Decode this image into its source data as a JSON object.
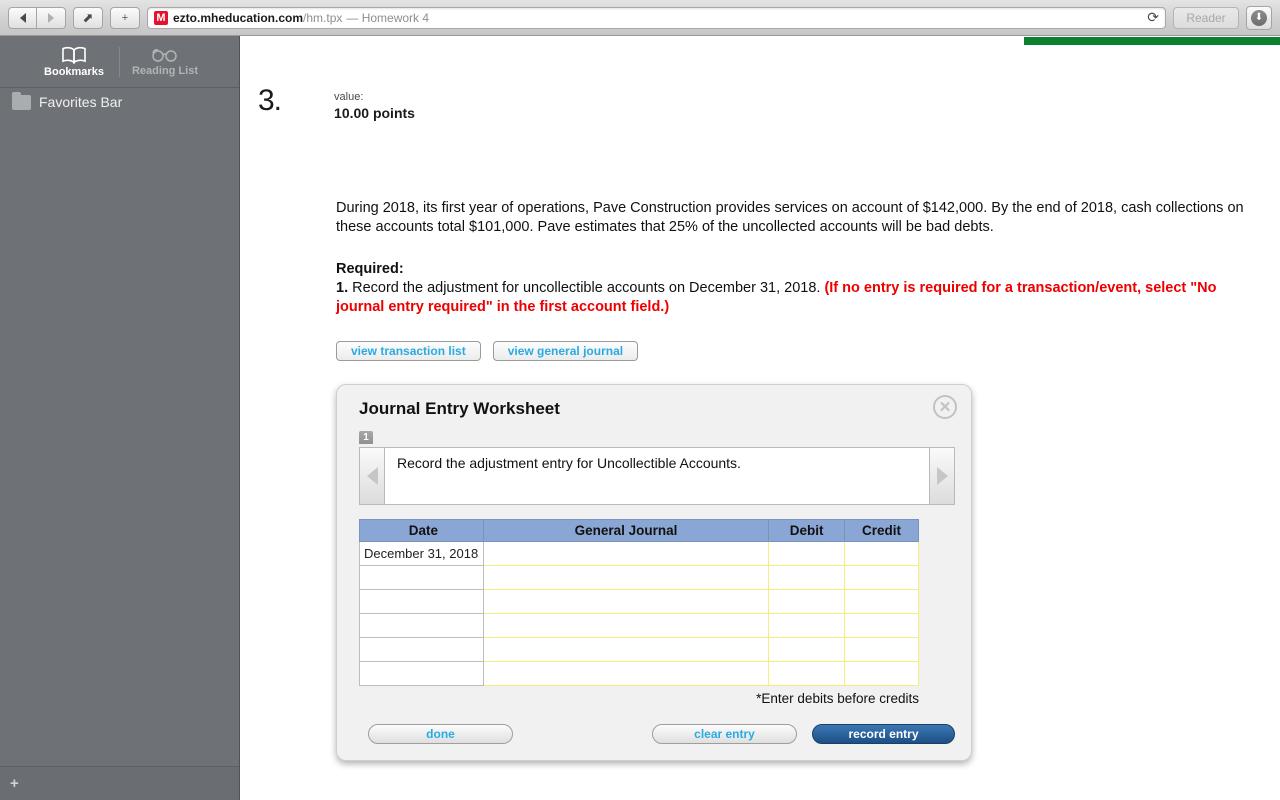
{
  "browser": {
    "back_icon": "back-arrow-icon",
    "forward_icon": "forward-arrow-icon",
    "share_icon": "share-icon",
    "share_glyph": "⬈",
    "new_tab_label": "+",
    "favicon_letter": "M",
    "url_host": "ezto.mheducation.com",
    "url_path": "/hm.tpx",
    "page_title": "— Homework 4",
    "reload_glyph": "⟳",
    "reader_label": "Reader",
    "download_glyph": "⬇"
  },
  "sidebar": {
    "tabs": [
      {
        "label": "Bookmarks",
        "icon": "book-icon"
      },
      {
        "label": "Reading List",
        "icon": "glasses-icon"
      }
    ],
    "items": [
      {
        "label": "Favorites Bar",
        "icon": "folder-icon"
      }
    ],
    "add_label": "+"
  },
  "question": {
    "number": "3.",
    "value_label": "value:",
    "points": "10.00 points",
    "problem_text": "During 2018, its first year of operations, Pave Construction provides services on account of $142,000. By the end of 2018, cash collections on these accounts total $101,000. Pave estimates that 25% of the uncollected accounts will be bad debts.",
    "required_title": "Required:",
    "required_number": "1.",
    "required_text": " Record the adjustment for uncollectible accounts on December 31, 2018. ",
    "required_note": "(If no entry is required for a transaction/event, select \"No journal entry required\" in the first account field.)",
    "view_buttons": [
      {
        "label": "view transaction list"
      },
      {
        "label": "view general journal"
      }
    ]
  },
  "worksheet": {
    "title": "Journal Entry Worksheet",
    "close_label": "✕",
    "tabs": [
      {
        "label": "1"
      }
    ],
    "prev_icon": "chevron-left-icon",
    "next_icon": "chevron-right-icon",
    "instruction": "Record the adjustment entry for Uncollectible Accounts.",
    "columns": [
      "Date",
      "General Journal",
      "Debit",
      "Credit"
    ],
    "rows": [
      {
        "date": "December 31, 2018",
        "general_journal": "",
        "debit": "",
        "credit": ""
      },
      {
        "date": "",
        "general_journal": "",
        "debit": "",
        "credit": ""
      },
      {
        "date": "",
        "general_journal": "",
        "debit": "",
        "credit": ""
      },
      {
        "date": "",
        "general_journal": "",
        "debit": "",
        "credit": ""
      },
      {
        "date": "",
        "general_journal": "",
        "debit": "",
        "credit": ""
      },
      {
        "date": "",
        "general_journal": "",
        "debit": "",
        "credit": ""
      }
    ],
    "note": "*Enter debits before credits",
    "buttons": {
      "done": "done",
      "clear": "clear entry",
      "record": "record entry"
    }
  },
  "colors": {
    "progress_green": "#0d8030",
    "header_blue": "#8aa6d4",
    "link_blue": "#29abe2",
    "alert_red": "#ee0000",
    "input_border_yellow": "#f2f07a"
  }
}
